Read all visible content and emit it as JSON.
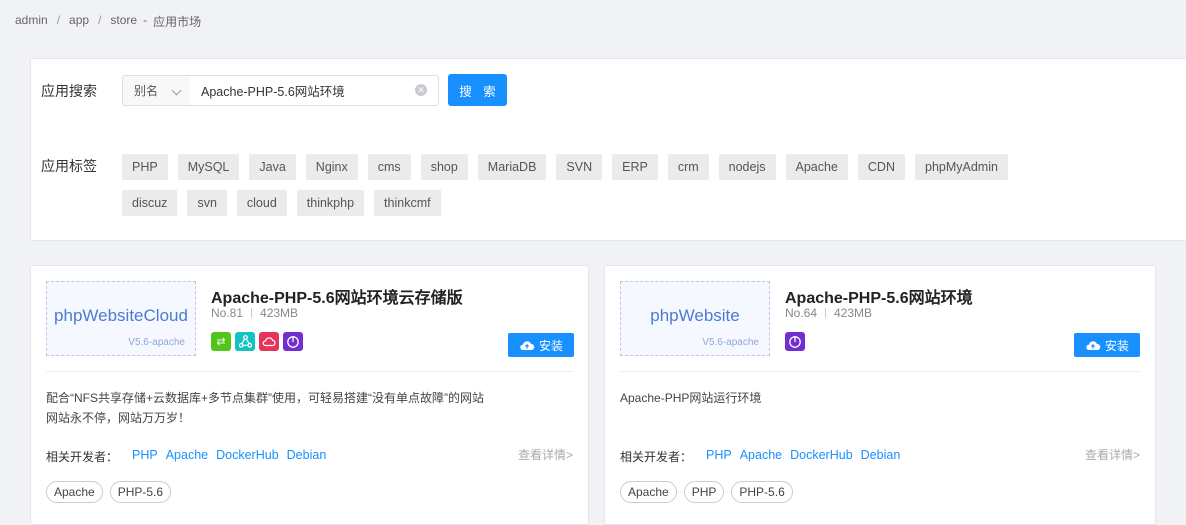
{
  "breadcrumb": {
    "items": [
      "admin",
      "app",
      "store"
    ],
    "current": "应用市场"
  },
  "search": {
    "label": "应用搜索",
    "select_value": "别名",
    "input_value": "Apache-PHP-5.6网站环境",
    "button_label": "搜 索"
  },
  "tag_filter": {
    "label": "应用标签",
    "row1": [
      "PHP",
      "MySQL",
      "Java",
      "Nginx",
      "cms",
      "shop",
      "MariaDB",
      "SVN",
      "ERP",
      "crm",
      "nodejs",
      "Apache",
      "CDN",
      "phpMyAdmin"
    ],
    "row2": [
      "discuz",
      "svn",
      "cloud",
      "thinkphp",
      "thinkcmf"
    ]
  },
  "cards": [
    {
      "logo_title": "phpWebsiteCloud",
      "logo_sub": "V5.6-apache",
      "title": "Apache-PHP-5.6网站环境云存储版",
      "number": "No.81",
      "size": "423MB",
      "badges": [
        "transfer-icon",
        "share-icon",
        "cloud-icon",
        "power-icon"
      ],
      "install_label": "安装",
      "desc_line1": "配合“NFS共享存储+云数据库+多节点集群”使用，可轻易搭建“没有单点故障”的网站",
      "desc_line2": "网站永不停，网站万万岁！",
      "dev_label": "相关开发者：",
      "devs": [
        "PHP",
        "Apache",
        "DockerHub",
        "Debian"
      ],
      "detail_label": "查看详情>",
      "chips": [
        "Apache",
        "PHP-5.6"
      ]
    },
    {
      "logo_title": "phpWebsite",
      "logo_sub": "V5.6-apache",
      "title": "Apache-PHP-5.6网站环境",
      "number": "No.64",
      "size": "423MB",
      "badges": [
        "power-icon"
      ],
      "install_label": "安装",
      "desc_line1": "Apache-PHP网站运行环境",
      "dev_label": "相关开发者：",
      "devs": [
        "PHP",
        "Apache",
        "DockerHub",
        "Debian"
      ],
      "detail_label": "查看详情>",
      "chips": [
        "Apache",
        "PHP",
        "PHP-5.6"
      ]
    }
  ],
  "colors": {
    "accent": "#1890ff",
    "badge_green": "#52c41a",
    "badge_teal": "#13c2c2",
    "badge_red": "#f5222d",
    "badge_purple": "#722ed1"
  }
}
